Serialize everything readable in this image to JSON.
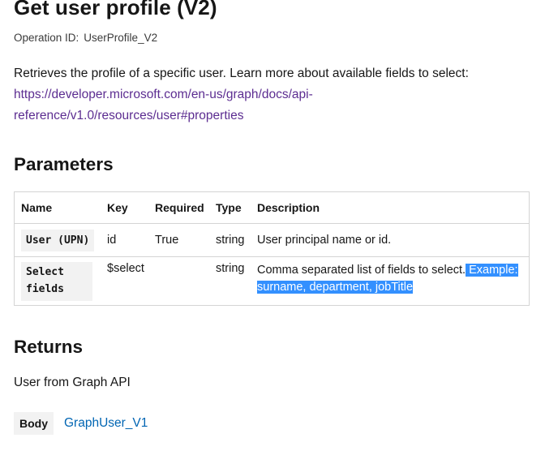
{
  "header": {
    "title": "Get user profile (V2)",
    "operation_id_label": "Operation ID:",
    "operation_id_value": "UserProfile_V2"
  },
  "description": {
    "text": "Retrieves the profile of a specific user. Learn more about available fields to select:",
    "link_line1": "https://developer.microsoft.com/en-us/graph/docs/api-",
    "link_line2": "reference/v1.0/resources/user#properties"
  },
  "parameters": {
    "heading": "Parameters",
    "columns": [
      "Name",
      "Key",
      "Required",
      "Type",
      "Description"
    ],
    "rows": [
      {
        "name": "User (UPN)",
        "key": "id",
        "required": "True",
        "type": "string",
        "description": "User principal name or id.",
        "description_highlight": ""
      },
      {
        "name": "Select fields",
        "key": "$select",
        "required": "",
        "type": "string",
        "description": "Comma separated list of fields to select.",
        "description_highlight": " Example: surname, department, jobTitle"
      }
    ]
  },
  "returns": {
    "heading": "Returns",
    "text": "User from Graph API",
    "body_label": "Body",
    "body_link": "GraphUser_V1"
  },
  "colors": {
    "link_visited": "#5c2d91",
    "link": "#0065b3",
    "selection": "#3390ff",
    "code_bg": "#f2f2f2"
  }
}
